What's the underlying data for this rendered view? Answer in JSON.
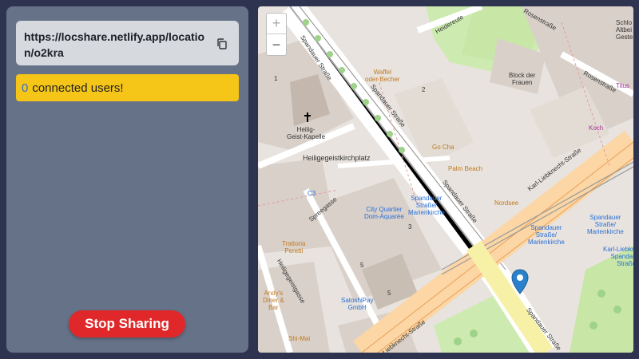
{
  "sidebar": {
    "url": "https://locshare.netlify.app/location/o2kra",
    "users_count": "0",
    "users_text": "connected users!",
    "stop_label": "Stop Sharing"
  },
  "map": {
    "zoom_in": "+",
    "zoom_out": "−",
    "labels": {
      "heiligegeistkapelle": "Heilig-\nGeist-Kapelle",
      "heiligegeistkirchplatz": "Heiligegeistkirchplatz",
      "spandauer1": "Spandauer Straße",
      "spandauer2": "Spandauer Straße",
      "spandauer3": "Spandauer Straße",
      "spandauer4": "Spandauer Straße",
      "spreegasse": "Spreegasse",
      "heiligegeistgasse": "Heiligegeistgasse",
      "karl1": "Karl-Liebknecht-Straße",
      "karl2": "Liebknecht-Straße",
      "rosenstrasse": "Rosenstraße",
      "rosenstrasse2": "Rosenstraße",
      "heidereuterg": "Heidereute",
      "waffel": "Waffel\noder Becher",
      "block": "Block der\nFrauen",
      "gocha": "Go Cha",
      "palmbeach": "Palm Beach",
      "koch": "Koch",
      "titus": "Titus",
      "nordsee": "Nordsee",
      "cityquartier": "City Quartier\nDom-Aquarée",
      "spandauer_stop1": "Spandauer\nStraße/\nMarienkirche",
      "spandauer_stop2": "Spandauer\nStraße/\nMarienkirche",
      "spandauer_stop3": "Spandauer\nStraße/\nMarienkirche",
      "karlstop": "Karl-Liebknecht-\nSpandauer\nStraße",
      "trattoria": "Trattoria\nPeretti",
      "satoshi": "SatoshiPay\nGmbH",
      "andys": "Andy's\nDiner &\nBar",
      "shimai": "Shi-Mai",
      "c3": "C3",
      "schloss": "Schlo\nAltbei\nGeste",
      "num1": "1",
      "num2": "2",
      "num3": "3",
      "num5a": "5",
      "num5b": "5"
    }
  },
  "colors": {
    "panel": "#667288",
    "background": "#2e3350",
    "users_bg": "#f5c518",
    "stop_bg": "#e0282a",
    "marker": "#2a81cb"
  }
}
